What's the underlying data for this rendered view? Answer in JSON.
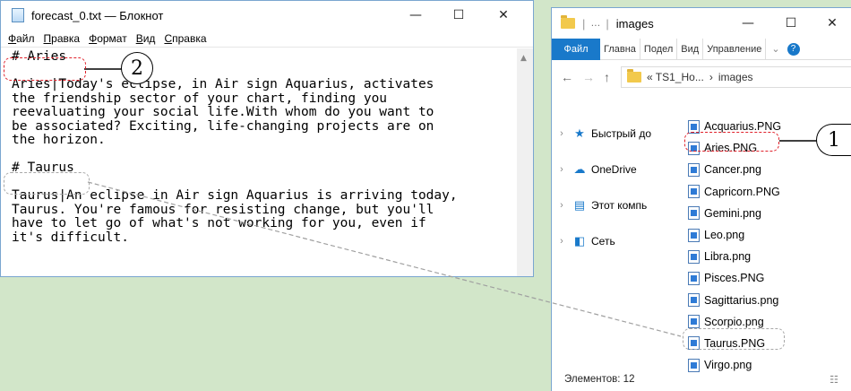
{
  "notepad": {
    "title": "forecast_0.txt — Блокнот",
    "menu": [
      "Файл",
      "Правка",
      "Формат",
      "Вид",
      "Справка"
    ],
    "lines": [
      "# Aries",
      "",
      "Aries|Today's eclipse, in Air sign Aquarius, activates",
      "the friendship sector of your chart, finding you",
      "reevaluating your social life.With whom do you want to",
      "be associated? Exciting, life-changing projects are on",
      "the horizon.",
      "",
      "# Taurus",
      "",
      "Taurus|An eclipse in Air sign Aquarius is arriving today,",
      "Taurus. You're famous for resisting change, but you'll",
      "have to let go of what's not working for you, even if",
      "it's difficult."
    ]
  },
  "explorer": {
    "title": "images",
    "ribbon": [
      "Файл",
      "Главна",
      "Подел",
      "Вид",
      "Управление"
    ],
    "path": [
      "« TS1_Ho...",
      "›",
      "images"
    ],
    "nav": [
      {
        "label": "Быстрый до",
        "icon": "star-icon"
      },
      {
        "label": "OneDrive",
        "icon": "cloud-icon"
      },
      {
        "label": "Этот компь",
        "icon": "computer-icon"
      },
      {
        "label": "Сеть",
        "icon": "network-icon"
      }
    ],
    "files": [
      "Acquarius.PNG",
      "Aries.PNG",
      "Cancer.png",
      "Capricorn.PNG",
      "Gemini.png",
      "Leo.png",
      "Libra.png",
      "Pisces.PNG",
      "Sagittarius.png",
      "Scorpio.png",
      "Taurus.PNG",
      "Virgo.png"
    ],
    "status": "Элементов: 12"
  },
  "callouts": [
    "1",
    "2"
  ],
  "colors": {
    "accent": "#1979ca",
    "highlight": "#e0202a",
    "background": "#d2e6c9"
  }
}
